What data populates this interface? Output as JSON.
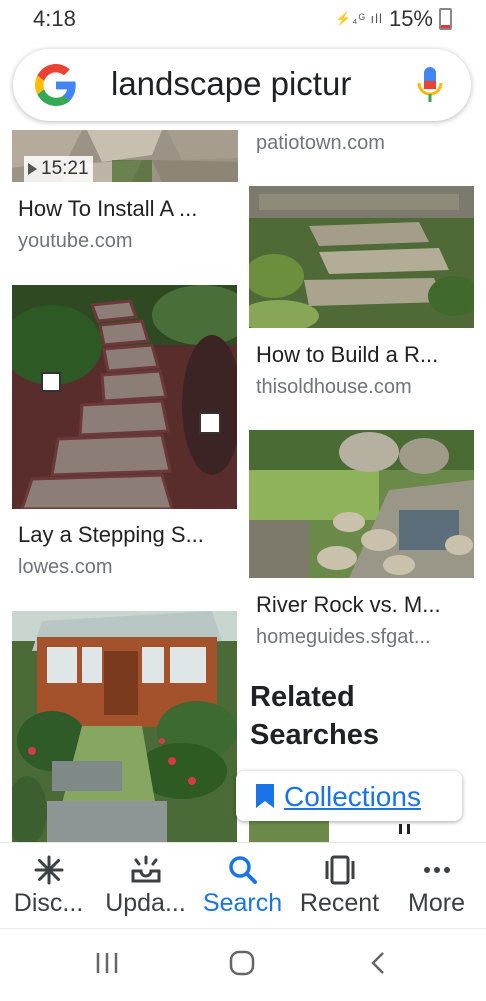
{
  "status_bar": {
    "time": "4:18",
    "signal_icons": "⚡₄ᴳ ıll",
    "battery": "15%"
  },
  "search": {
    "query": "landscape pictur"
  },
  "results": [
    {
      "title": "How To Install A ...",
      "source": "youtube.com",
      "duration": "15:21"
    },
    {
      "title": "",
      "source": "patiotown.com"
    },
    {
      "title": "How to Build a R...",
      "source": "thisoldhouse.com"
    },
    {
      "title": "Lay a Stepping S...",
      "source": "lowes.com"
    },
    {
      "title": "River Rock vs. M...",
      "source": "homeguides.sfgat..."
    }
  ],
  "related": {
    "heading_line1": "Related",
    "heading_line2": "Searches"
  },
  "collections": {
    "label": "Collections"
  },
  "bottom_nav": [
    {
      "label": "Disc...",
      "icon": "asterisk-icon"
    },
    {
      "label": "Upda...",
      "icon": "updates-icon"
    },
    {
      "label": "Search",
      "icon": "search-icon",
      "active": true
    },
    {
      "label": "Recent",
      "icon": "recent-icon"
    },
    {
      "label": "More",
      "icon": "more-icon"
    }
  ],
  "colors": {
    "accent": "#1a73e8",
    "source_gray": "#70757a"
  }
}
